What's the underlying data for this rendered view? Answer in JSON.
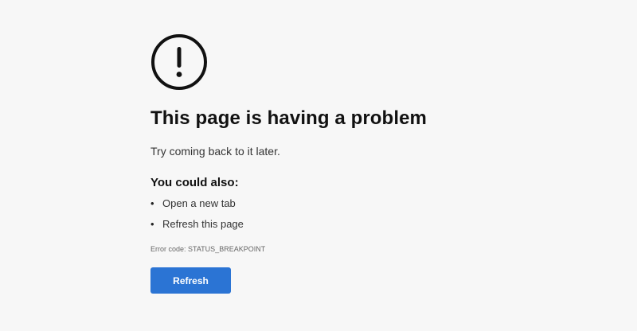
{
  "error_page": {
    "icon": "exclamation-circle-icon",
    "title": "This page is having a problem",
    "subtitle": "Try coming back to it later.",
    "also_heading": "You could also:",
    "suggestions": [
      {
        "bullet": "•",
        "label": "Open a new tab"
      },
      {
        "bullet": "•",
        "label": "Refresh this page"
      }
    ],
    "error_code": "Error code: STATUS_BREAKPOINT",
    "refresh_label": "Refresh"
  },
  "colors": {
    "background": "#f7f7f7",
    "button": "#2b74d4",
    "button_text": "#ffffff",
    "icon": "#111111"
  }
}
